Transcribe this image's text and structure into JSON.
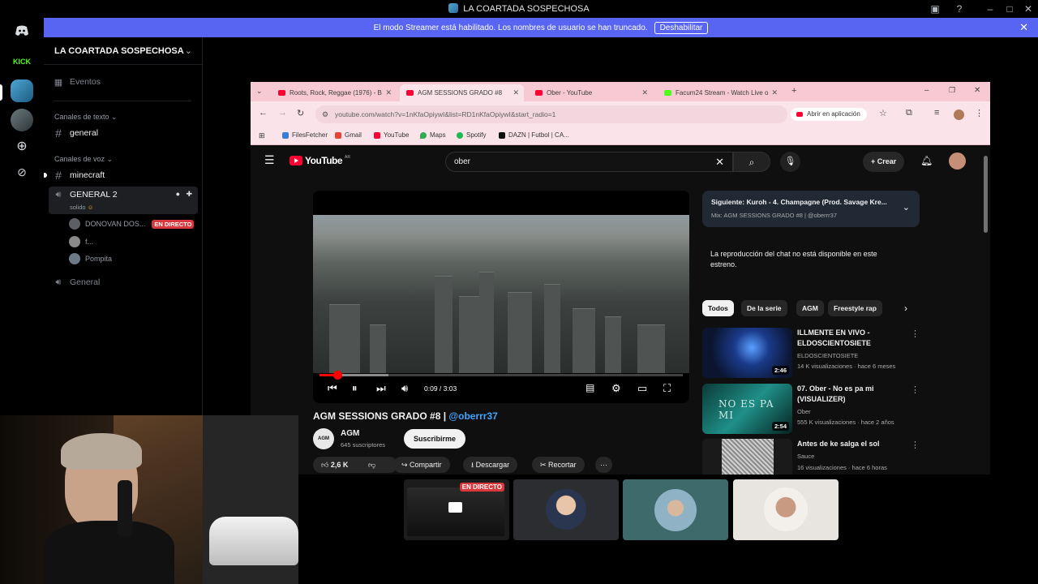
{
  "window": {
    "title": "LA COARTADA SOSPECHOSA"
  },
  "banner": {
    "text": "El modo Streamer está habilitado. Los nombres de usuario se han truncado.",
    "button": "Deshabilitar"
  },
  "rail": {
    "kick_label": "KICK"
  },
  "sidebar": {
    "server_name": "LA COARTADA SOSPECHOSA",
    "events": "Eventos",
    "text_category": "Canales de texto",
    "text_channels": [
      "general"
    ],
    "voice_category": "Canales de voz",
    "minecraft": "minecraft",
    "voice_channel": {
      "name": "GENERAL 2",
      "status": "solido",
      "users": [
        {
          "name": "DONOVAN DOS...",
          "live": "EN DIRECTO"
        },
        {
          "name": "f..."
        },
        {
          "name": "Pompita"
        }
      ]
    },
    "voice_channel_2": "General"
  },
  "browser": {
    "tabs": [
      {
        "label": "Roots, Rock, Reggae (1976) - B"
      },
      {
        "label": "AGM SESSIONS GRADO #8"
      },
      {
        "label": "Ober - YouTube"
      },
      {
        "label": "Facum24 Stream - Watch Live o"
      }
    ],
    "url": "youtube.com/watch?v=1nKfaOpiywI&list=RD1nKfaOpiywI&start_radio=1",
    "open_in_app": "Abrir en aplicación",
    "bookmarks": [
      "FilesFetcher",
      "Gmail",
      "YouTube",
      "Maps",
      "Spotify",
      "DAZN | Futbol | CA..."
    ]
  },
  "youtube": {
    "logo": "YouTube",
    "region": "AR",
    "search_value": "ober",
    "create": "Crear",
    "player": {
      "time": "0:09 / 3:03",
      "progress": 0.05,
      "buffered": 0.19
    },
    "video_title": "AGM SESSIONS GRADO #8 |",
    "video_tag": "@oberrr37",
    "channel": {
      "name": "AGM",
      "subs": "645 suscriptores",
      "subscribe": "Suscribirme",
      "avatar_text": "AGM"
    },
    "actions": {
      "likes": "2,6 K",
      "share": "Compartir",
      "download": "Descargar",
      "clip": "Recortar"
    },
    "up_next": {
      "title": "Siguiente: Kuroh - 4. Champagne (Prod. Savage Kre...",
      "sub": "Mix: AGM SESSIONS GRADO #8 | @oberrr37"
    },
    "chat_msg": "La reproducción del chat no está disponible en este estreno.",
    "chips": [
      "Todos",
      "De la serie",
      "AGM",
      "Freestyle rap"
    ],
    "recs": [
      {
        "title": "ILLMENTE EN VIVO - ELDOSCIENTOSIETE",
        "channel": "ELDOSCIENTOSIETE",
        "meta": "14 K visualizaciones · hace 6 meses",
        "duration": "2:46"
      },
      {
        "title": "07. Ober - No es pa mi (VISUALIZER)",
        "channel": "Ober",
        "meta": "555 K visualizaciones · hace 2 años",
        "duration": "2:54",
        "thumb_text": "NO ES PA MI"
      },
      {
        "title": "Antes de ke salga el sol",
        "channel": "Sauce",
        "meta": "16 visualizaciones · hace 6 horas",
        "duration": ""
      }
    ]
  },
  "tiles": {
    "live_label": "EN DIRECTO"
  }
}
